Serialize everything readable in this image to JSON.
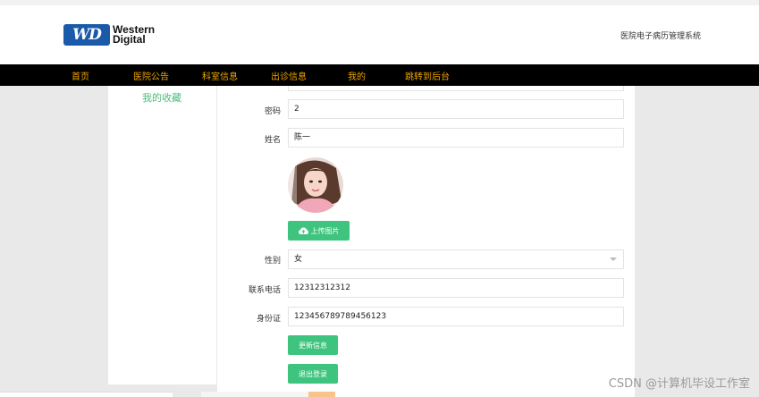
{
  "header": {
    "logo_line1": "Western",
    "logo_line2": "Digital",
    "logo_mark": "WD",
    "system_title": "医院电子病历管理系统"
  },
  "nav": {
    "items": [
      "首页",
      "医院公告",
      "科室信息",
      "出诊信息",
      "我的",
      "跳转到后台"
    ]
  },
  "sidebar": {
    "favorites_label": "我的收藏"
  },
  "form": {
    "password_label": "密码",
    "password_value": "2",
    "name_label": "姓名",
    "name_value": "陈一",
    "upload_button": "上传图片",
    "gender_label": "性别",
    "gender_value": "女",
    "phone_label": "联系电话",
    "phone_value": "12312312312",
    "id_label": "身份证",
    "id_value": "123456789789456123",
    "update_button": "更新信息",
    "logout_button": "退出登录"
  },
  "watermark": "CSDN @计算机毕设工作室",
  "colors": {
    "nav_bg": "#000000",
    "nav_text": "#f0a500",
    "accent_green": "#3ec47e",
    "sidebar_link": "#4bbd7a"
  }
}
